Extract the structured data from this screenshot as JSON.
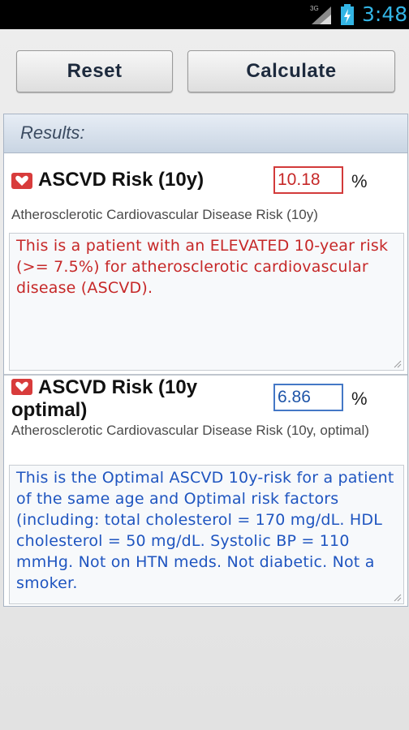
{
  "status": {
    "time": "3:48",
    "network": "3G"
  },
  "toolbar": {
    "reset_label": "Reset",
    "calculate_label": "Calculate"
  },
  "results": {
    "header": "Results:",
    "items": [
      {
        "title_line1": "ASCVD Risk (10y)",
        "title_line2": "",
        "value": "10.18",
        "unit": "%",
        "subtitle": "Atherosclerotic Cardiovascular Disease Risk (10y)",
        "note": "This is a patient with an ELEVATED 10-year risk (>= 7.5%) for atherosclerotic cardiovascular disease (ASCVD).",
        "color": "#c62828"
      },
      {
        "title_line1": "ASCVD Risk (10y",
        "title_line2": "optimal)",
        "value": "6.86",
        "unit": "%",
        "subtitle": "Atherosclerotic Cardiovascular Disease Risk (10y, optimal)",
        "note": "This is the Optimal ASCVD 10y-risk for a patient of the same age and Optimal risk factors (including: total cholesterol = 170 mg/dL. HDL cholesterol = 50 mg/dL. Systolic BP = 110 mmHg. Not on HTN meds. Not diabetic. Not a smoker.",
        "color": "#1f55c0"
      }
    ]
  },
  "icons": {
    "signal": "signal-icon",
    "battery": "battery-charging-icon",
    "heart": "heart-icon",
    "resize": "resize-grip-icon"
  }
}
